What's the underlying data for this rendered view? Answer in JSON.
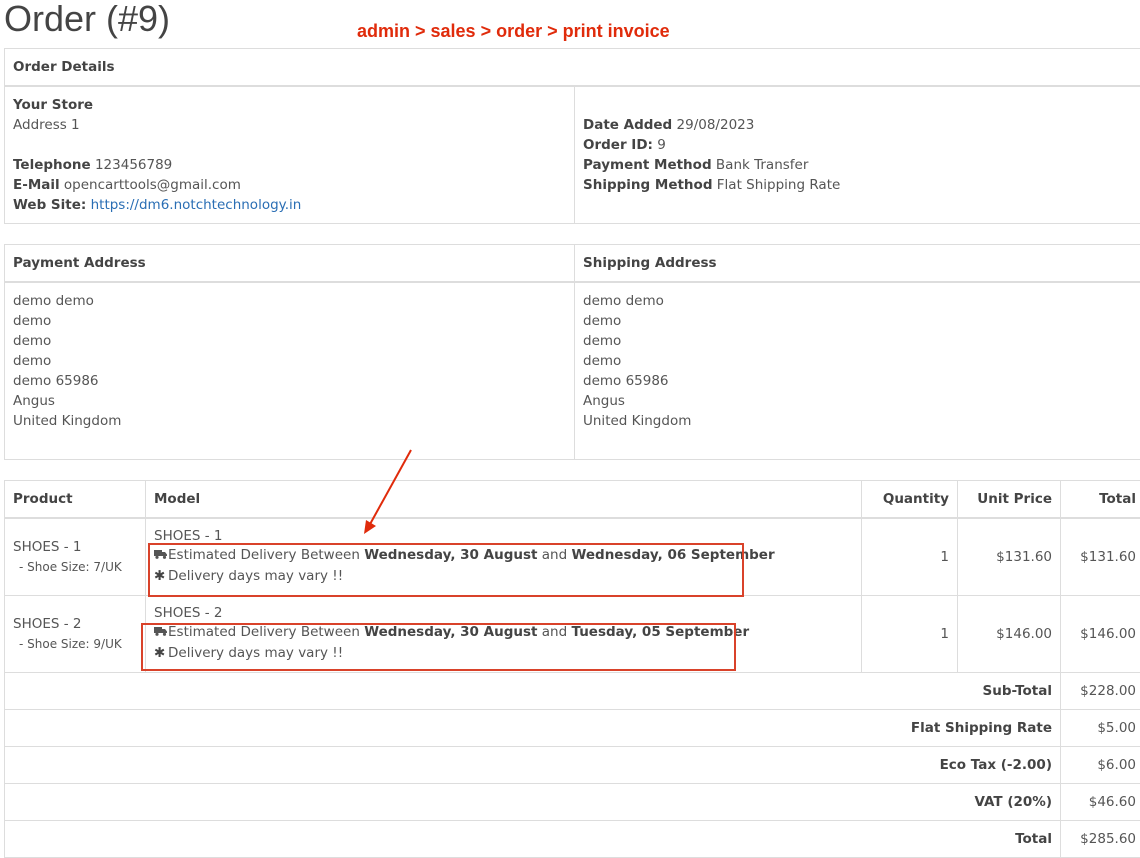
{
  "page_title": "Order (#9)",
  "annotation": "admin > sales > order > print invoice",
  "order_details": {
    "heading": "Order Details",
    "store": {
      "name": "Your Store",
      "address": "Address 1",
      "telephone_label": "Telephone",
      "telephone": "123456789",
      "email_label": "E-Mail",
      "email": "opencarttools@gmail.com",
      "website_label": "Web Site:",
      "website": "https://dm6.notchtechnology.in"
    },
    "info": {
      "date_added_label": "Date Added",
      "date_added": "29/08/2023",
      "order_id_label": "Order ID:",
      "order_id": "9",
      "payment_method_label": "Payment Method",
      "payment_method": "Bank Transfer",
      "shipping_method_label": "Shipping Method",
      "shipping_method": "Flat Shipping Rate"
    }
  },
  "addresses": {
    "payment_heading": "Payment Address",
    "shipping_heading": "Shipping Address",
    "payment_lines": [
      "demo demo",
      "demo",
      "demo",
      "demo",
      "demo 65986",
      "Angus",
      "United Kingdom"
    ],
    "shipping_lines": [
      "demo demo",
      "demo",
      "demo",
      "demo",
      "demo 65986",
      "Angus",
      "United Kingdom"
    ]
  },
  "products": {
    "columns": {
      "product": "Product",
      "model": "Model",
      "quantity": "Quantity",
      "unit_price": "Unit Price",
      "total": "Total"
    },
    "rows": [
      {
        "name": "SHOES - 1",
        "option": "- Shoe Size: 7/UK",
        "model": "SHOES - 1",
        "delivery_prefix": "Estimated Delivery Between",
        "delivery_from": "Wednesday, 30 August",
        "delivery_and": "and",
        "delivery_to": "Wednesday, 06 September",
        "delivery_note": "Delivery days may vary !!",
        "quantity": "1",
        "unit_price": "$131.60",
        "total": "$131.60"
      },
      {
        "name": "SHOES - 2",
        "option": "- Shoe Size: 9/UK",
        "model": "SHOES - 2",
        "delivery_prefix": "Estimated Delivery Between",
        "delivery_from": "Wednesday, 30 August",
        "delivery_and": "and",
        "delivery_to": "Tuesday, 05 September",
        "delivery_note": "Delivery days may vary !!",
        "quantity": "1",
        "unit_price": "$146.00",
        "total": "$146.00"
      }
    ],
    "totals": [
      {
        "label": "Sub-Total",
        "value": "$228.00"
      },
      {
        "label": "Flat Shipping Rate",
        "value": "$5.00"
      },
      {
        "label": "Eco Tax (-2.00)",
        "value": "$6.00"
      },
      {
        "label": "VAT (20%)",
        "value": "$46.60"
      },
      {
        "label": "Total",
        "value": "$285.60"
      }
    ]
  },
  "icons": {
    "delivery": "truck-icon",
    "note": "asterisk-icon"
  },
  "colors": {
    "annotation": "#e02b0b",
    "highlight_box": "#d9422a",
    "link": "#2a6eb4"
  }
}
